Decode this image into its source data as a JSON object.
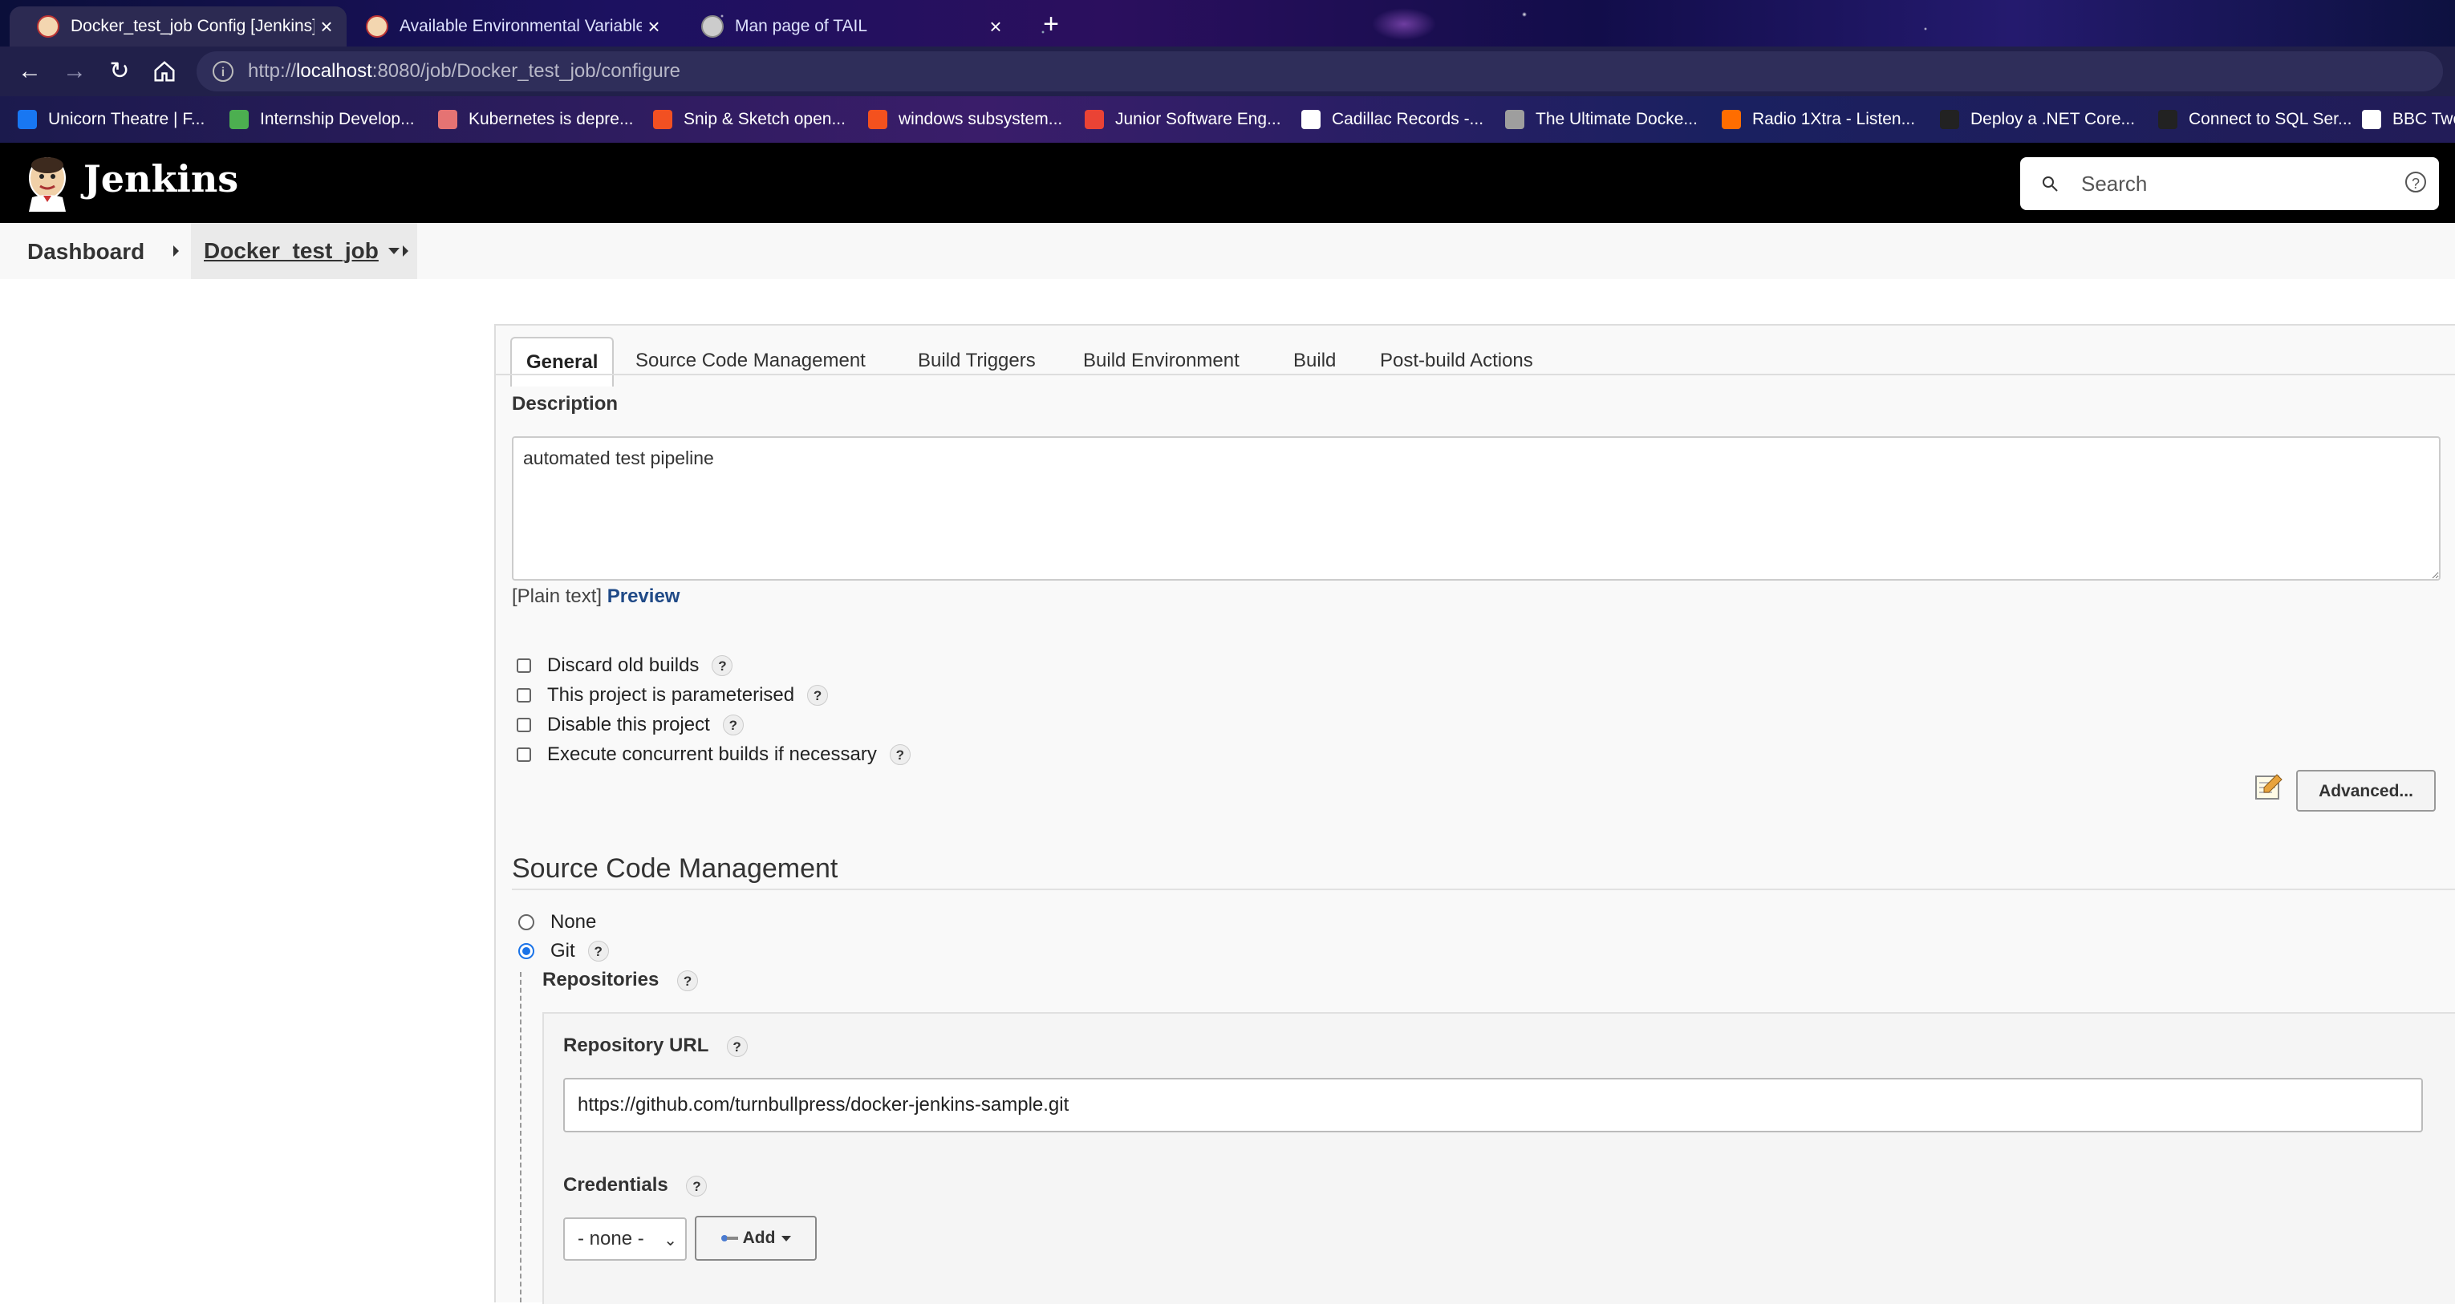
{
  "browser": {
    "tabs": [
      {
        "title": "Docker_test_job Config [Jenkins]",
        "active": true
      },
      {
        "title": "Available Environmental Variable",
        "active": false
      },
      {
        "title": "Man page of TAIL",
        "active": false
      }
    ],
    "new_tab_label": "+",
    "address": {
      "scheme": "http://",
      "host": "localhost",
      "rest": ":8080/job/Docker_test_job/configure"
    },
    "bookmarks": [
      {
        "label": "Unicorn Theatre | F...",
        "color": "#1877f2"
      },
      {
        "label": "Internship Develop...",
        "color": "#4caf50"
      },
      {
        "label": "Kubernetes is depre...",
        "color": "#e57373"
      },
      {
        "label": "Snip & Sketch open...",
        "color": "#f25022"
      },
      {
        "label": "windows subsystem...",
        "color": "#f4511e"
      },
      {
        "label": "Junior Software Eng...",
        "color": "#ea4335"
      },
      {
        "label": "Cadillac Records -...",
        "color": "#ffffff"
      },
      {
        "label": "The Ultimate Docke...",
        "color": "#9e9e9e"
      },
      {
        "label": "Radio 1Xtra - Listen...",
        "color": "#ff6d00"
      },
      {
        "label": "Deploy a .NET Core...",
        "color": "#222222"
      },
      {
        "label": "Connect to SQL Ser...",
        "color": "#222222"
      },
      {
        "label": "BBC Two",
        "color": "#ffffff"
      }
    ]
  },
  "jenkins": {
    "brand": "Jenkins",
    "search_placeholder": "Search",
    "help_symbol": "?"
  },
  "breadcrumb": {
    "dashboard": "Dashboard",
    "job": "Docker_test_job"
  },
  "config": {
    "tabs": [
      "General",
      "Source Code Management",
      "Build Triggers",
      "Build Environment",
      "Build",
      "Post-build Actions"
    ],
    "active_tab": "General",
    "description_label": "Description",
    "description_value": "automated test pipeline",
    "plain_text": "[Plain text]",
    "preview_link": "Preview",
    "options": [
      {
        "label": "Discard old builds",
        "checked": false
      },
      {
        "label": "This project is parameterised",
        "checked": false
      },
      {
        "label": "Disable this project",
        "checked": false
      },
      {
        "label": "Execute concurrent builds if necessary",
        "checked": false
      }
    ],
    "advanced_button": "Advanced...",
    "scm_heading": "Source Code Management",
    "scm_options": [
      {
        "label": "None",
        "selected": false
      },
      {
        "label": "Git",
        "selected": true
      }
    ],
    "repositories_label": "Repositories",
    "repo_url_label": "Repository URL",
    "repo_url_value": "https://github.com/turnbullpress/docker-jenkins-sample.git",
    "credentials_label": "Credentials",
    "credentials_selected": "- none -",
    "add_button": "Add",
    "help_symbol": "?"
  },
  "colors": {
    "accent": "#1a73e8",
    "link": "#204a87",
    "header_bg": "#000000"
  }
}
